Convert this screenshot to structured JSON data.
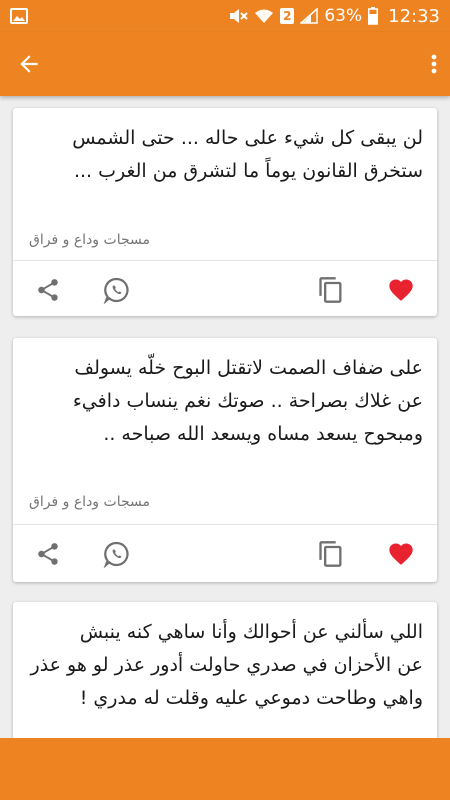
{
  "status_bar": {
    "battery": "63%",
    "time": "12:33",
    "sim": "2",
    "icons": [
      "image-icon",
      "mute-icon",
      "wifi-icon",
      "signal-icon",
      "battery-icon"
    ]
  },
  "app_bar": {
    "icons": [
      "back-arrow-icon",
      "more-vert-icon"
    ]
  },
  "colors": {
    "accent": "#ee8421",
    "heart": "#e8232f",
    "icon_gray": "#707070"
  },
  "cards": [
    {
      "text": "لن يبقى كل شيء على حاله ... حتى الشمس\nستخرق القانون يوماً ما لتشرق من الغرب ...",
      "category": "مسجات وداع و فراق",
      "liked": true
    },
    {
      "text": "على ضفاف الصمت لاتقتل البوح خلّه يسولف\nعن غلاك بصراحة .. صوتك نغم ينساب دافيء\nومبحوح يسعد مساه ويسعد الله صباحه ..",
      "category": "مسجات وداع و فراق",
      "liked": true
    },
    {
      "text": "اللي سألني عن أحوالك وأنا ساهي كنه ينبش\nعن الأحزان في صدري حاولت أدور عذر لو هو عذر\nواهي وطاحت دموعي عليه وقلت له مدري !",
      "category": "",
      "liked": false
    }
  ]
}
